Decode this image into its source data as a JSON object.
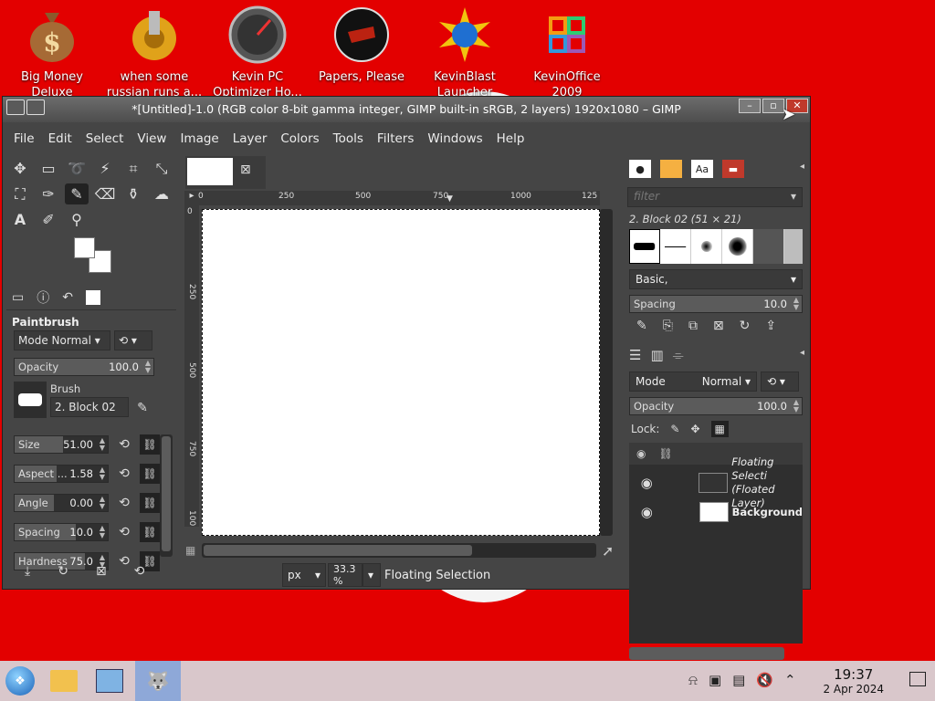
{
  "desktop": {
    "icons": [
      {
        "label": "Big Money Deluxe",
        "icon": "money-bag-icon"
      },
      {
        "label": "when some russian runs a...",
        "icon": "gears-icon"
      },
      {
        "label": "Kevin PC Optimizer Ho...",
        "icon": "gauge-icon"
      },
      {
        "label": "Papers, Please",
        "icon": "papers-please-icon"
      },
      {
        "label": "KevinBlast Launcher",
        "icon": "starburst-icon"
      },
      {
        "label": "KevinOffice 2009",
        "icon": "office-icon"
      }
    ]
  },
  "window": {
    "title": "*[Untitled]-1.0 (RGB color 8-bit gamma integer, GIMP built-in sRGB, 2 layers) 1920x1080 – GIMP",
    "menu": [
      "File",
      "Edit",
      "Select",
      "View",
      "Image",
      "Layer",
      "Colors",
      "Tools",
      "Filters",
      "Windows",
      "Help"
    ]
  },
  "tool_options": {
    "title": "Paintbrush",
    "mode_label": "Mode",
    "mode_value": "Normal",
    "opacity_label": "Opacity",
    "opacity_value": "100.0",
    "brush_label": "Brush",
    "brush_value": "2. Block 02",
    "sliders": [
      {
        "label": "Size",
        "value": "51.00",
        "fill": 0.52
      },
      {
        "label": "Aspect ...",
        "value": "1.58",
        "fill": 0.45
      },
      {
        "label": "Angle",
        "value": "0.00",
        "fill": 0.42
      },
      {
        "label": "Spacing",
        "value": "10.0",
        "fill": 0.66
      },
      {
        "label": "Hardness",
        "value": "75.0",
        "fill": 0.75
      }
    ]
  },
  "canvas": {
    "ruler_h": [
      "0",
      "250",
      "500",
      "750",
      "1000",
      "125"
    ],
    "ruler_v": [
      "0",
      "250",
      "500",
      "750",
      "100"
    ],
    "unit": "px",
    "zoom": "33.3 %",
    "status": "Floating Selection"
  },
  "brushes_dock": {
    "filter_placeholder": "filter",
    "brush_name": "2. Block 02 (51 × 21)",
    "preset": "Basic,",
    "spacing_label": "Spacing",
    "spacing_value": "10.0"
  },
  "layers_dock": {
    "mode_label": "Mode",
    "mode_value": "Normal",
    "opacity_label": "Opacity",
    "opacity_value": "100.0",
    "lock_label": "Lock:",
    "layers": [
      {
        "name": "Floating Selecti",
        "sub": "(Floated Layer)"
      },
      {
        "name": "Background",
        "sub": ""
      }
    ]
  },
  "taskbar": {
    "time": "19:37",
    "date": "2 Apr 2024"
  },
  "colors": {
    "desktop": "#e30000",
    "gimp_bg": "#454545",
    "taskbar": "#d9c7cb"
  }
}
